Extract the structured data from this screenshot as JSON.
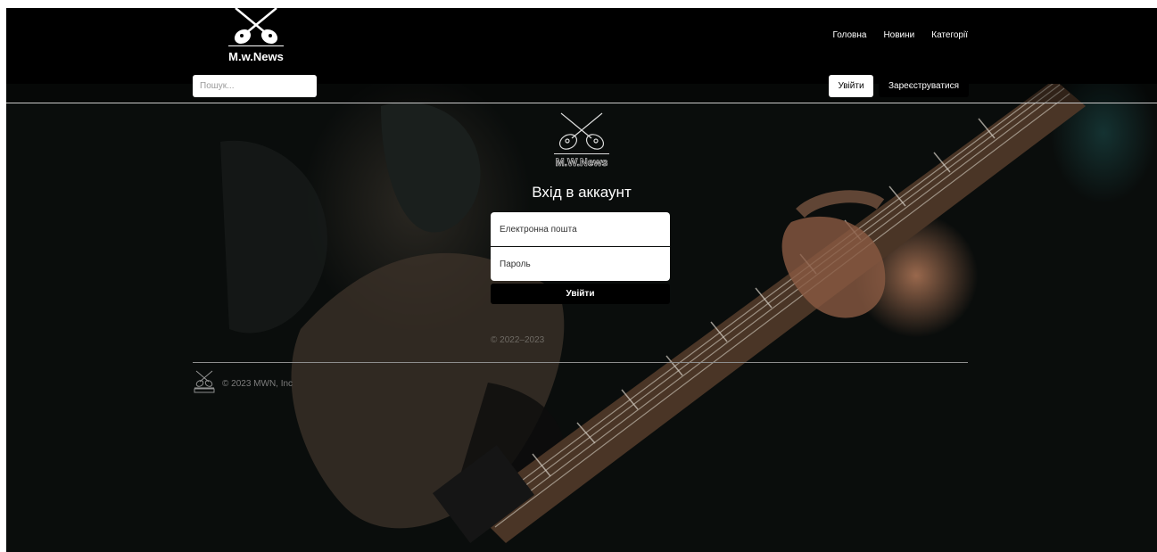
{
  "brand": {
    "name": "M.w.News",
    "small_name": "M.W.News"
  },
  "nav": [
    {
      "label": "Головна"
    },
    {
      "label": "Новини"
    },
    {
      "label": "Категорії"
    }
  ],
  "search": {
    "placeholder": "Пошук..."
  },
  "auth": {
    "login_label": "Увійти",
    "register_label": "Зареєструватися"
  },
  "login_form": {
    "title": "Вхід в аккаунт",
    "email_placeholder": "Електронна пошта",
    "password_placeholder": "Пароль",
    "submit_label": "Увійти",
    "copyright": "© 2022–2023"
  },
  "footer": {
    "text": "© 2023 MWN, Inc"
  },
  "colors": {
    "header_bg": "#000000",
    "accent": "#ffffff",
    "background": "#0a0d0c"
  },
  "icons": [
    "crossed-guitars-logo-icon"
  ]
}
